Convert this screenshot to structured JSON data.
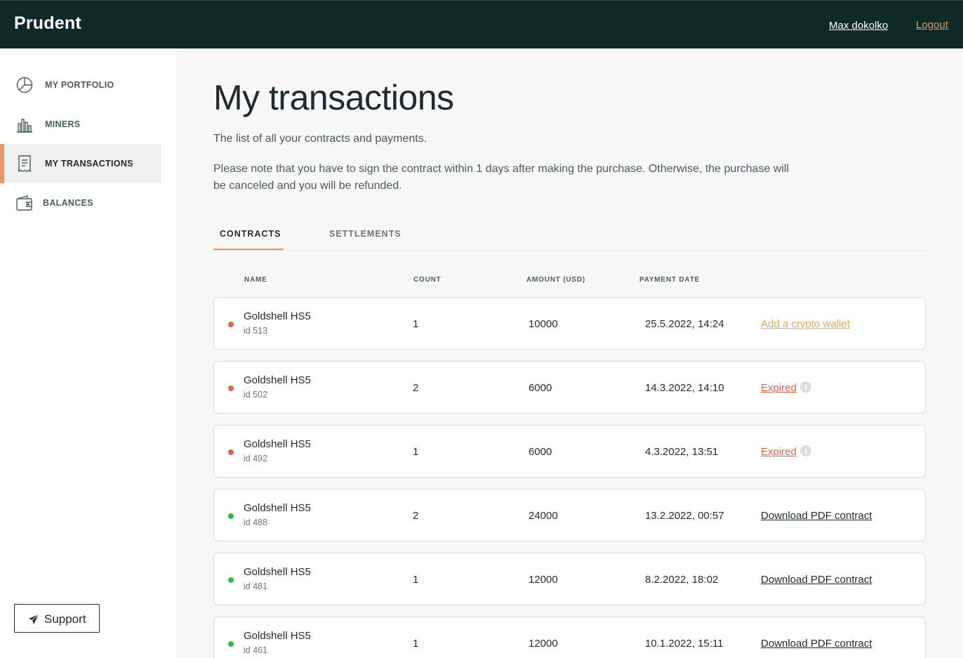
{
  "header": {
    "brand": "Prudent",
    "user_name": "Max dokolko",
    "logout_label": "Logout"
  },
  "sidebar": {
    "items": [
      {
        "label": "MY PORTFOLIO",
        "icon": "pie-chart-icon",
        "active": false
      },
      {
        "label": "MINERS",
        "icon": "bar-chart-icon",
        "active": false
      },
      {
        "label": "MY TRANSACTIONS",
        "icon": "receipt-icon",
        "active": true
      },
      {
        "label": "BALANCES",
        "icon": "wallet-icon",
        "active": false
      }
    ],
    "support_label": "Support",
    "support_icon": "send-icon"
  },
  "main": {
    "title": "My transactions",
    "subtitle": "The list of all your contracts and payments.",
    "note": "Please note that you have to sign the contract within 1 days after making the purchase. Otherwise, the purchase will be canceled and you will be refunded.",
    "tabs": [
      {
        "label": "CONTRACTS",
        "active": true
      },
      {
        "label": "SETTLEMENTS",
        "active": false
      }
    ],
    "columns": {
      "name": "NAME",
      "count": "COUNT",
      "amount": "AMOUNT (USD)",
      "payment_date": "PAYMENT DATE"
    },
    "rows": [
      {
        "name": "Goldshell HS5",
        "id": "id 513",
        "count": "1",
        "amount": "10000",
        "date": "25.5.2022, 14:24",
        "action": "Add a crypto wallet",
        "status": "red",
        "action_style": "orange",
        "info": false
      },
      {
        "name": "Goldshell HS5",
        "id": "id 502",
        "count": "2",
        "amount": "6000",
        "date": "14.3.2022, 14:10",
        "action": "Expired",
        "status": "red",
        "action_style": "red",
        "info": true
      },
      {
        "name": "Goldshell HS5",
        "id": "id 492",
        "count": "1",
        "amount": "6000",
        "date": "4.3.2022, 13:51",
        "action": "Expired",
        "status": "red",
        "action_style": "red",
        "info": true
      },
      {
        "name": "Goldshell HS5",
        "id": "id 488",
        "count": "2",
        "amount": "24000",
        "date": "13.2.2022, 00:57",
        "action": "Download PDF contract",
        "status": "green",
        "action_style": "dark",
        "info": false
      },
      {
        "name": "Goldshell HS5",
        "id": "id 481",
        "count": "1",
        "amount": "12000",
        "date": "8.2.2022, 18:02",
        "action": "Download PDF contract",
        "status": "green",
        "action_style": "dark",
        "info": false
      },
      {
        "name": "Goldshell HS5",
        "id": "id 461",
        "count": "1",
        "amount": "12000",
        "date": "10.1.2022, 15:11",
        "action": "Download PDF contract",
        "status": "green",
        "action_style": "dark",
        "info": false
      }
    ]
  },
  "colors": {
    "topbar": "#0e2a25",
    "accent": "#e8956a",
    "status_red": "#e0654a",
    "status_green": "#38b54a",
    "link_orange": "#e8a65a"
  }
}
